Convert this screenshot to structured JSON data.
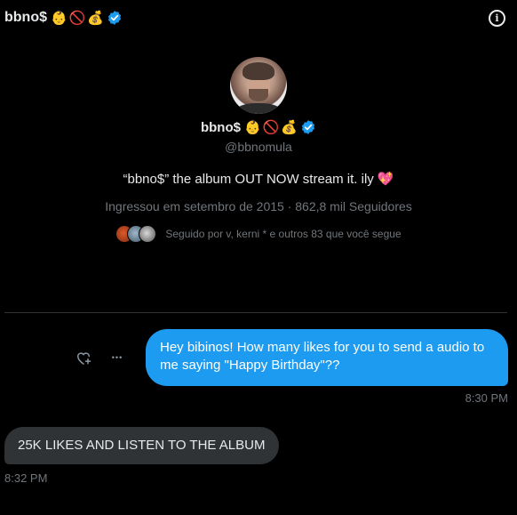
{
  "header": {
    "name": "bbno$",
    "emojis": [
      "👶",
      "🚫",
      "💰"
    ],
    "verified_icon": "verified-badge-icon",
    "info_icon": "info-icon",
    "info_glyph": "i"
  },
  "profile": {
    "name": "bbno$",
    "emojis": [
      "👶",
      "🚫",
      "💰"
    ],
    "handle": "@bbnomula",
    "bio": "“bbno$” the album OUT NOW stream it. ily",
    "bio_emoji": "💖",
    "meta": "Ingressou em setembro de 2015 · 862,8 mil Seguidores",
    "followed_by": "Seguido por v, kerni * e outros 83 que você segue"
  },
  "colors": {
    "accent": "#1d9bf0",
    "bubble_in": "#2f3336",
    "muted": "#71767b",
    "background": "#000000"
  },
  "conversation": {
    "sent_message": "Hey bibinos! How many likes for you to send a audio to me saying \"Happy Birthday\"??",
    "sent_time": "8:30 PM",
    "reaction_icon": "add-reaction-heart-icon",
    "more_icon": "more-horizontal-icon",
    "more_glyph": "•••",
    "received_message": "25K LIKES AND LISTEN TO THE ALBUM",
    "received_time": "8:32 PM"
  }
}
